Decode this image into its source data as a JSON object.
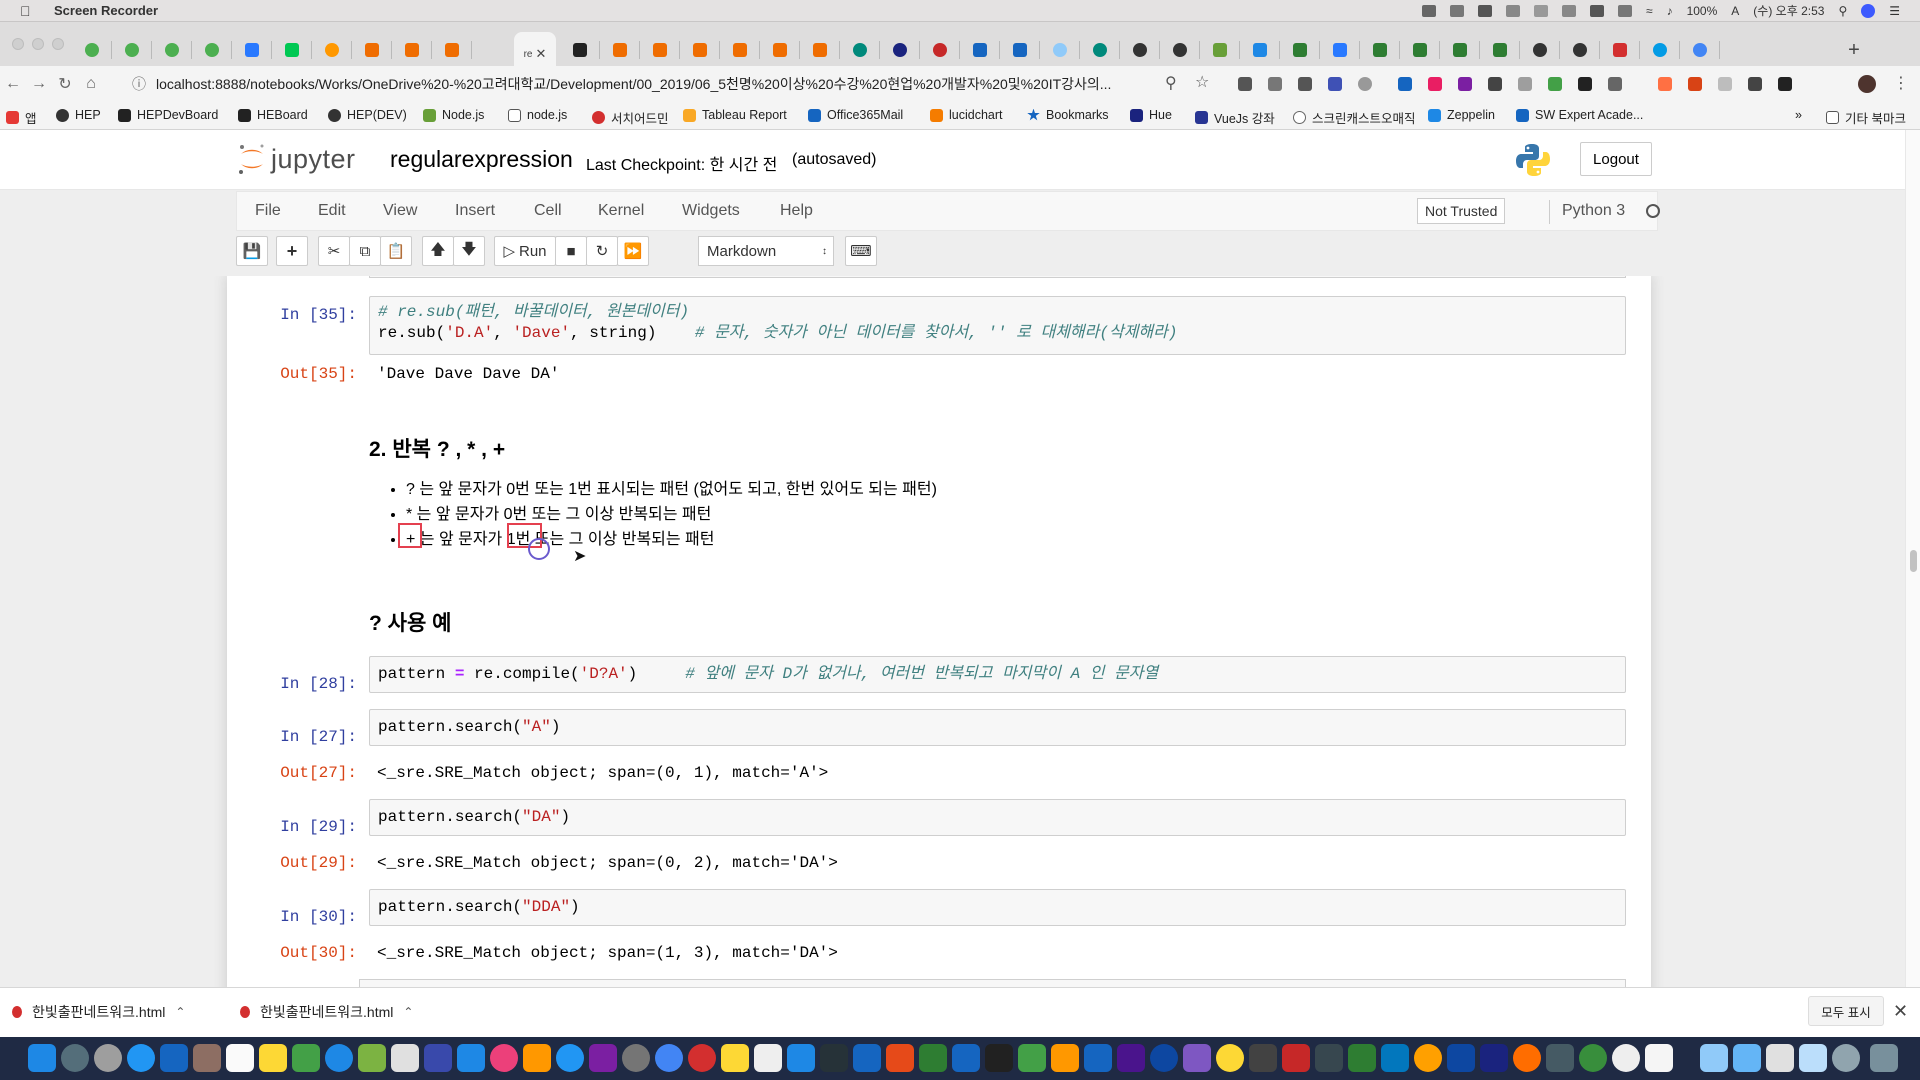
{
  "menubar": {
    "app_name": "Screen Recorder",
    "battery": "100%",
    "clock": "(수) 오후 2:53"
  },
  "browser": {
    "active_tab_label": "re",
    "url": "localhost:8888/notebooks/Works/OneDrive%20-%20고려대학교/Development/00_2019/06_5천명%20이상%20수강%20현업%20개발자%20및%20IT강사의...",
    "bookmarks": [
      "앱",
      "HEP",
      "HEPDevBoard",
      "HEBoard",
      "HEP(DEV)",
      "Node.js",
      "node.js",
      "서치어드민",
      "Tableau Report",
      "Office365Mail",
      "lucidchart",
      "Bookmarks",
      "Hue",
      "VueJs 강좌",
      "스크린캐스트오매직",
      "Zeppelin",
      "SW Expert Acade..."
    ],
    "other_bookmarks": "기타 북마크"
  },
  "jupyter": {
    "logo_text": "jupyter",
    "notebook_name": "regularexpression",
    "checkpoint": "Last Checkpoint: 한 시간 전",
    "autosaved": "(autosaved)",
    "logout_label": "Logout",
    "menu": [
      "File",
      "Edit",
      "View",
      "Insert",
      "Cell",
      "Kernel",
      "Widgets",
      "Help"
    ],
    "not_trusted": "Not Trusted",
    "kernel": "Python 3",
    "toolbar": {
      "run_label": "Run",
      "cell_type": "Markdown"
    }
  },
  "cells": {
    "c35": {
      "in_prompt": "In [35]:",
      "line1": "# re.sub(패턴, 바꿀데이터, 원본데이터)",
      "line2_code1": "re.sub(",
      "line2_str1": "'D.A'",
      "line2_code2": ", ",
      "line2_str2": "'Dave'",
      "line2_code3": ", string)    ",
      "line2_comment": "# 문자, 숫자가 아닌 데이터를 찾아서, '' 로 대체해라(삭제해라)",
      "out_prompt": "Out[35]:",
      "output": "'Dave Dave Dave DA'"
    },
    "md_repeat": {
      "heading": "2. 반복 ? , * , +",
      "bullet1": "? 는 앞 문자가 0번 또는 1번 표시되는 패턴 (없어도 되고, 한번 있어도 되는 패턴)",
      "bullet2": "* 는 앞 문자가 0번 또는 그 이상 반복되는 패턴",
      "bullet3": "+ 는 앞 문자가 1번 또는 그 이상 반복되는 패턴"
    },
    "md_example": {
      "heading": "? 사용 예"
    },
    "c28": {
      "in_prompt": "In [28]:",
      "code1": "pattern ",
      "op": "=",
      "code2": " re.compile(",
      "str": "'D?A'",
      "code3": ")     ",
      "comment": "# 앞에 문자 D가 없거나, 여러번 반복되고 마지막이 A 인 문자열"
    },
    "c27": {
      "in_prompt": "In [27]:",
      "code": "pattern.search(",
      "str": "\"A\"",
      "close": ")",
      "out_prompt": "Out[27]:",
      "output": "<_sre.SRE_Match object; span=(0, 1), match='A'>"
    },
    "c29": {
      "in_prompt": "In [29]:",
      "code": "pattern.search(",
      "str": "\"DA\"",
      "close": ")",
      "out_prompt": "Out[29]:",
      "output": "<_sre.SRE_Match object; span=(0, 2), match='DA'>"
    },
    "c30": {
      "in_prompt": "In [30]:",
      "code": "pattern.search(",
      "str": "\"DDA\"",
      "close": ")",
      "out_prompt": "Out[30]:",
      "output": "<_sre.SRE_Match object; span=(1, 3), match='DA'>"
    }
  },
  "downloads": {
    "items": [
      "한빛출판네트워크.html",
      "한빛출판네트워크.html"
    ],
    "show_all": "모두 표시"
  },
  "colors": {
    "prompt_in": "#303f9f",
    "prompt_out": "#d84315",
    "annotation": "#e4404f",
    "jupyter_orange": "#f37726"
  }
}
